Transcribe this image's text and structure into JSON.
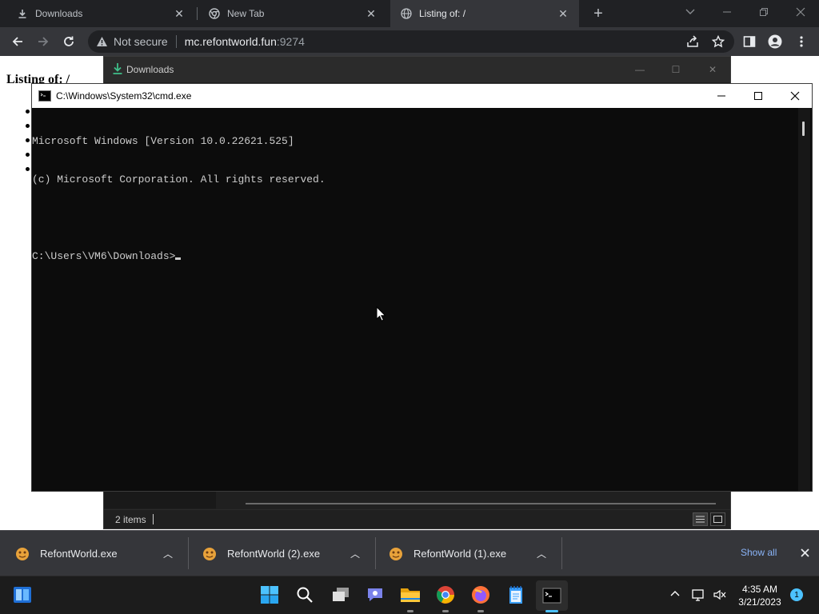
{
  "browser": {
    "tabs": [
      {
        "label": "Downloads",
        "icon": "download-icon",
        "active": false
      },
      {
        "label": "New Tab",
        "icon": "chrome-icon",
        "active": false
      },
      {
        "label": "Listing of: /",
        "icon": "globe-icon",
        "active": true
      }
    ],
    "address": {
      "security": "Not secure",
      "host": "mc.refontworld.fun",
      "port": ":9274"
    }
  },
  "page": {
    "title": "Listing of: /"
  },
  "downloads_window": {
    "title": "Downloads",
    "status_count": "2 items"
  },
  "cmd_window": {
    "title": "C:\\Windows\\System32\\cmd.exe",
    "lines": [
      "Microsoft Windows [Version 10.0.22621.525]",
      "(c) Microsoft Corporation. All rights reserved.",
      "",
      "C:\\Users\\VM6\\Downloads>"
    ]
  },
  "download_shelf": {
    "items": [
      {
        "name": "RefontWorld.exe"
      },
      {
        "name": "RefontWorld (2).exe"
      },
      {
        "name": "RefontWorld (1).exe"
      }
    ],
    "show_all": "Show all"
  },
  "taskbar": {
    "time": "4:35 AM",
    "date": "3/21/2023",
    "notification_count": "1"
  },
  "colors": {
    "chrome_dark": "#202124",
    "chrome_toolbar": "#35363a",
    "link_blue": "#8ab4f8",
    "console_bg": "#0c0c0c",
    "console_text": "#cccccc",
    "taskbar_bg": "#1c1c1c",
    "windows_accent": "#4cc2ff"
  }
}
